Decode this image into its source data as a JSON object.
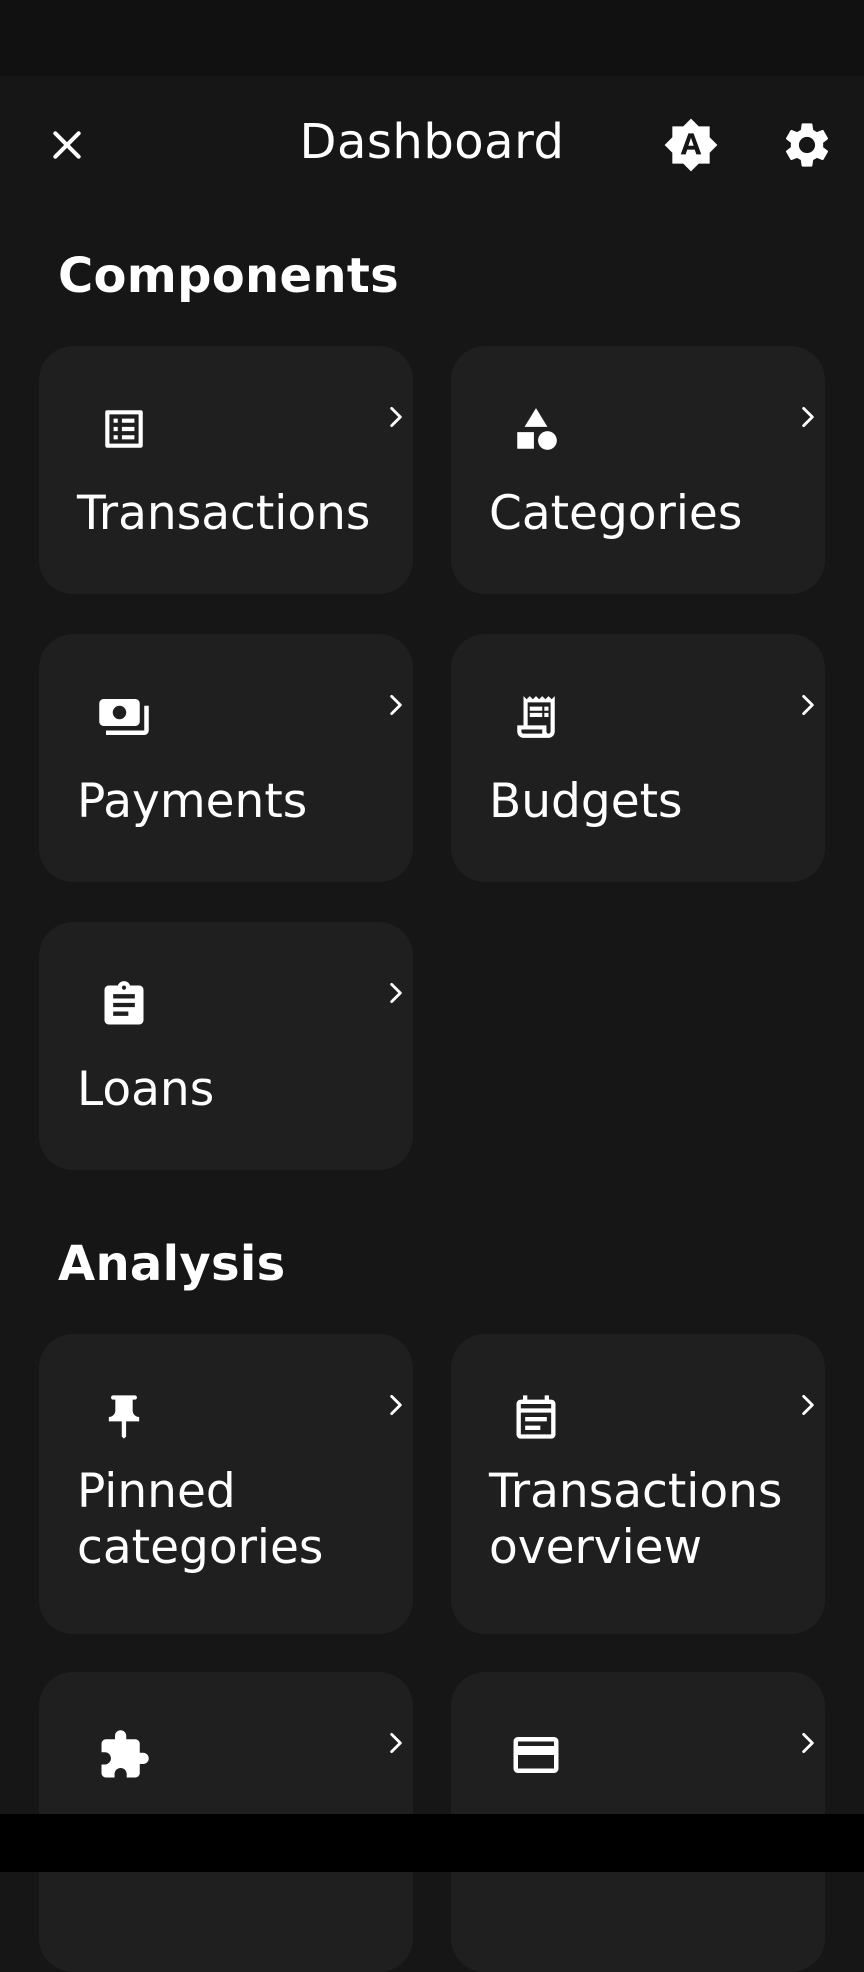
{
  "header": {
    "title": "Dashboard",
    "close_icon": "close-icon",
    "auto_icon": "auto-theme-icon",
    "settings_icon": "gear-icon"
  },
  "sections": {
    "components": {
      "title": "Components",
      "items": [
        {
          "label": "Transactions",
          "icon": "list-alt-icon"
        },
        {
          "label": "Categories",
          "icon": "category-shapes-icon"
        },
        {
          "label": "Payments",
          "icon": "payments-icon"
        },
        {
          "label": "Budgets",
          "icon": "receipt-long-icon"
        },
        {
          "label": "Loans",
          "icon": "assignment-icon"
        }
      ]
    },
    "analysis": {
      "title": "Analysis",
      "items": [
        {
          "label": "Pinned categories",
          "icon": "push-pin-icon"
        },
        {
          "label": "Transactions overview",
          "icon": "calendar-icon"
        },
        {
          "label": "",
          "icon": "extension-puzzle-icon"
        },
        {
          "label": "",
          "icon": "credit-card-icon"
        }
      ]
    }
  },
  "colors": {
    "background": "#161616",
    "card": "#1f1f1f",
    "text": "#ffffff"
  }
}
